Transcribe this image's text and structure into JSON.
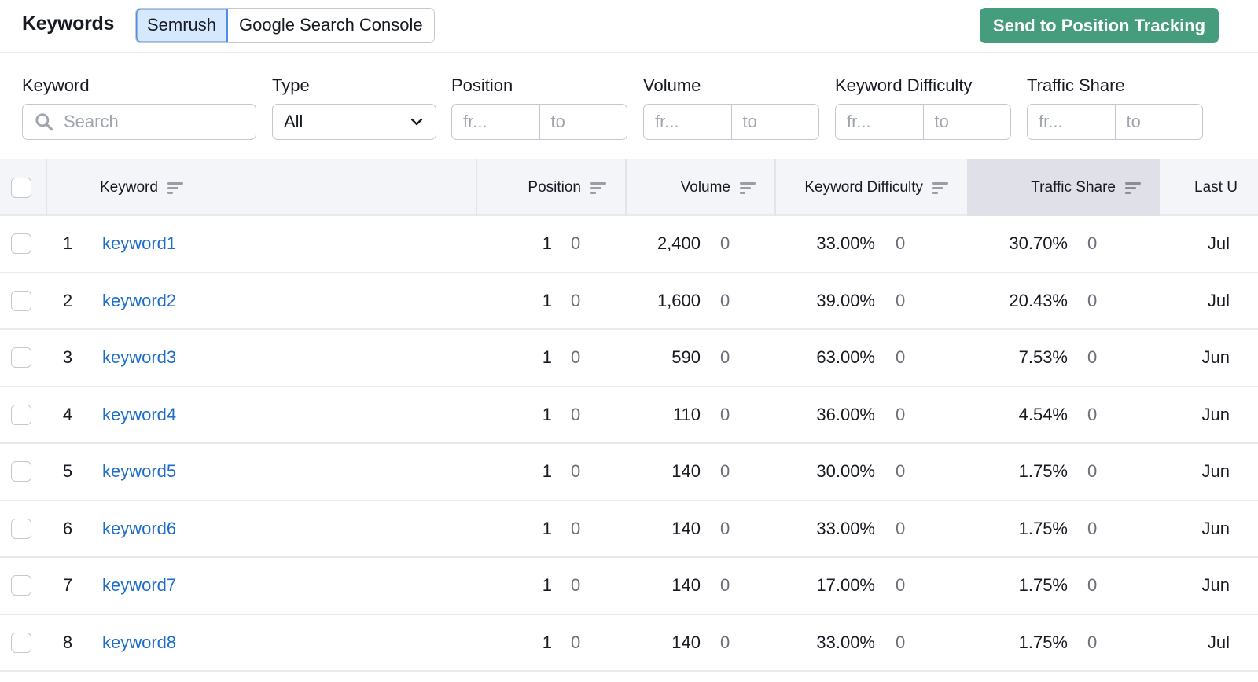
{
  "header": {
    "title": "Keywords",
    "tabs": [
      {
        "label": "Semrush",
        "active": true
      },
      {
        "label": "Google Search Console",
        "active": false
      }
    ],
    "send_button": "Send to Position Tracking"
  },
  "colors": {
    "accent_green": "#459d7d",
    "link_blue": "#1e6ec8",
    "active_tab_bg": "#d6e8fd",
    "active_tab_border": "#4f8de6"
  },
  "filters": {
    "keyword": {
      "label": "Keyword",
      "placeholder": "Search",
      "value": ""
    },
    "type": {
      "label": "Type",
      "selected": "All"
    },
    "position": {
      "label": "Position",
      "from_placeholder": "fr...",
      "to_placeholder": "to"
    },
    "volume": {
      "label": "Volume",
      "from_placeholder": "fr...",
      "to_placeholder": "to"
    },
    "keyword_difficulty": {
      "label": "Keyword Difficulty",
      "from_placeholder": "fr...",
      "to_placeholder": "to"
    },
    "traffic_share": {
      "label": "Traffic Share",
      "from_placeholder": "fr...",
      "to_placeholder": "to"
    }
  },
  "table": {
    "columns": {
      "keyword": "Keyword",
      "position": "Position",
      "volume": "Volume",
      "keyword_difficulty": "Keyword Difficulty",
      "traffic_share": "Traffic Share",
      "last_updated": "Last U"
    },
    "sorted_column": "traffic_share",
    "rows": [
      {
        "index": "1",
        "keyword": "keyword1",
        "position": "1",
        "position_diff": "0",
        "volume": "2,400",
        "volume_diff": "0",
        "kd": "33.00%",
        "kd_diff": "0",
        "traffic_share": "30.70%",
        "ts_diff": "0",
        "last_updated": "Jul"
      },
      {
        "index": "2",
        "keyword": "keyword2",
        "position": "1",
        "position_diff": "0",
        "volume": "1,600",
        "volume_diff": "0",
        "kd": "39.00%",
        "kd_diff": "0",
        "traffic_share": "20.43%",
        "ts_diff": "0",
        "last_updated": "Jul"
      },
      {
        "index": "3",
        "keyword": "keyword3",
        "position": "1",
        "position_diff": "0",
        "volume": "590",
        "volume_diff": "0",
        "kd": "63.00%",
        "kd_diff": "0",
        "traffic_share": "7.53%",
        "ts_diff": "0",
        "last_updated": "Jun"
      },
      {
        "index": "4",
        "keyword": "keyword4",
        "position": "1",
        "position_diff": "0",
        "volume": "110",
        "volume_diff": "0",
        "kd": "36.00%",
        "kd_diff": "0",
        "traffic_share": "4.54%",
        "ts_diff": "0",
        "last_updated": "Jun"
      },
      {
        "index": "5",
        "keyword": "keyword5",
        "position": "1",
        "position_diff": "0",
        "volume": "140",
        "volume_diff": "0",
        "kd": "30.00%",
        "kd_diff": "0",
        "traffic_share": "1.75%",
        "ts_diff": "0",
        "last_updated": "Jun"
      },
      {
        "index": "6",
        "keyword": "keyword6",
        "position": "1",
        "position_diff": "0",
        "volume": "140",
        "volume_diff": "0",
        "kd": "33.00%",
        "kd_diff": "0",
        "traffic_share": "1.75%",
        "ts_diff": "0",
        "last_updated": "Jun"
      },
      {
        "index": "7",
        "keyword": "keyword7",
        "position": "1",
        "position_diff": "0",
        "volume": "140",
        "volume_diff": "0",
        "kd": "17.00%",
        "kd_diff": "0",
        "traffic_share": "1.75%",
        "ts_diff": "0",
        "last_updated": "Jun"
      },
      {
        "index": "8",
        "keyword": "keyword8",
        "position": "1",
        "position_diff": "0",
        "volume": "140",
        "volume_diff": "0",
        "kd": "33.00%",
        "kd_diff": "0",
        "traffic_share": "1.75%",
        "ts_diff": "0",
        "last_updated": "Jul"
      }
    ]
  },
  "icons": {
    "search": "search-icon",
    "dropdown": "chevron-down-icon",
    "sort": "sort-icon"
  }
}
